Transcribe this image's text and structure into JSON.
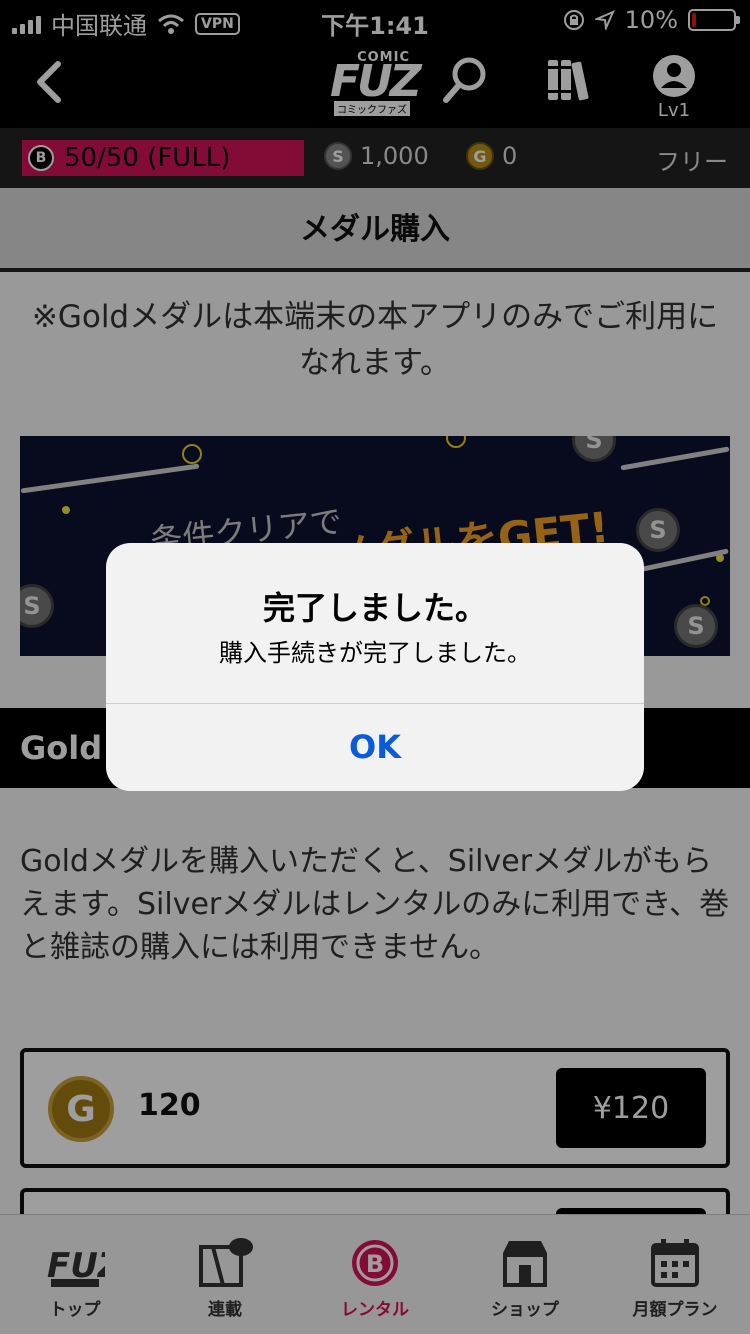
{
  "status_bar": {
    "carrier": "中国联通",
    "vpn": "VPN",
    "time": "下午1:41",
    "battery": "10%",
    "battery_level": 0.1
  },
  "header": {
    "logo_main": "FUZ",
    "logo_top": "COMIC",
    "logo_sub": "コミックファズ",
    "level": "Lv1",
    "icons": [
      "back-icon",
      "search-icon",
      "library-icon",
      "user-icon"
    ]
  },
  "medal_bar": {
    "bronze_symbol": "B",
    "bronze_value": "50/50 (FULL)",
    "silver_symbol": "S",
    "silver_value": "1,000",
    "gold_symbol": "G",
    "gold_value": "0",
    "plan": "フリー"
  },
  "page": {
    "title": "メダル購入",
    "notice": "※Goldメダルは本端末の本アプリのみでご利用になれます。",
    "banner_text_1": "条件クリアで",
    "banner_text_2": "メダルをGET!",
    "banner_coin_symbol": "S",
    "section_title": "Gold",
    "description": "Goldメダルを購入いただくと、Silverメダルがもらえます。Silverメダルはレンタルのみに利用でき、巻と雑誌の購入には利用できません。",
    "products": [
      {
        "symbol": "G",
        "amount": "120",
        "price": "¥120"
      }
    ]
  },
  "alert": {
    "title": "完了しました。",
    "message": "購入手続きが完了しました。",
    "ok_label": "OK"
  },
  "tab_bar": {
    "active_color": "#d2145a",
    "rental_symbol": "B",
    "tabs": [
      {
        "label": "トップ",
        "icon": "fuz-logo-icon"
      },
      {
        "label": "連載",
        "icon": "serial-icon"
      },
      {
        "label": "レンタル",
        "icon": "rental-b-icon"
      },
      {
        "label": "ショップ",
        "icon": "shop-icon"
      },
      {
        "label": "月額プラン",
        "icon": "calendar-icon"
      }
    ]
  }
}
